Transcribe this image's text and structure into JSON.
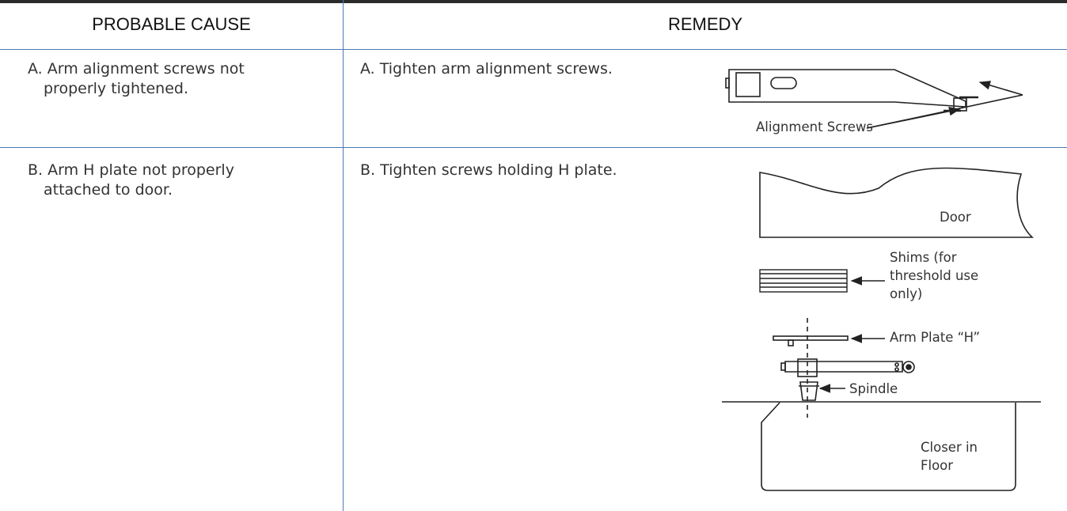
{
  "header": {
    "cause_label": "PROBABLE CAUSE",
    "remedy_label": "REMEDY"
  },
  "rows": [
    {
      "cause_line1": "A. Arm alignment screws not",
      "cause_line2": "properly tightened.",
      "remedy": "A. Tighten arm alignment screws."
    },
    {
      "cause_line1": "B. Arm H plate not properly",
      "cause_line2": "attached to door.",
      "remedy": "B. Tighten screws holding H plate."
    }
  ],
  "diagram_a": {
    "label": "Alignment Screws"
  },
  "diagram_b": {
    "door": "Door",
    "shims_line1": "Shims (for",
    "shims_line2": "threshold use",
    "shims_line3": "only)",
    "arm_plate": "Arm Plate “H”",
    "spindle": "Spindle",
    "closer_line1": "Closer in",
    "closer_line2": "Floor"
  },
  "colors": {
    "rule": "#4a7ab4",
    "header_rule": "#2b2b2b",
    "ink": "#222222"
  }
}
